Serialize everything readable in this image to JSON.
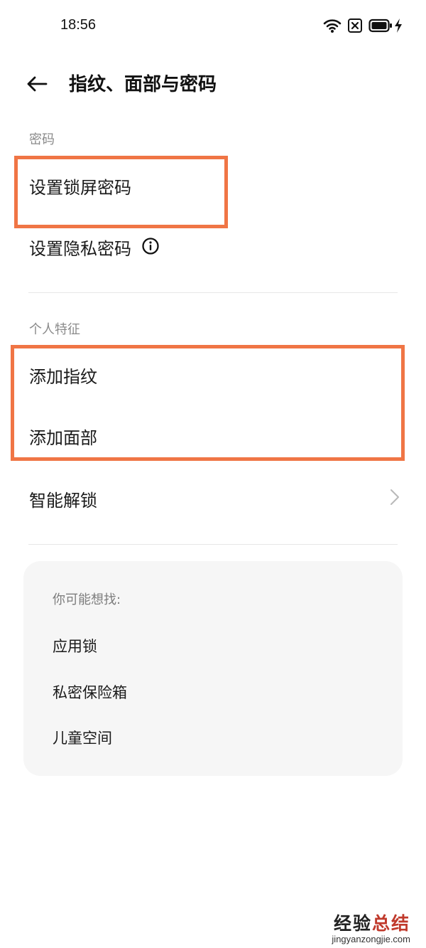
{
  "status_bar": {
    "time": "18:56",
    "icons": [
      "wifi-icon",
      "sim-error-icon",
      "battery-icon",
      "charging-icon"
    ]
  },
  "header": {
    "back_icon": "arrow-left-icon",
    "title": "指纹、面部与密码"
  },
  "password_section": {
    "label": "密码",
    "items": [
      {
        "label": "设置锁屏密码",
        "highlighted": true
      },
      {
        "label": "设置隐私密码",
        "info_icon": "info-icon"
      }
    ]
  },
  "biometric_section": {
    "label": "个人特征",
    "items": [
      {
        "label": "添加指纹",
        "highlighted": true
      },
      {
        "label": "添加面部",
        "highlighted": true
      },
      {
        "label": "智能解锁",
        "chevron": "chevron-right-icon"
      }
    ]
  },
  "suggestions": {
    "label": "你可能想找:",
    "items": [
      "应用锁",
      "私密保险箱",
      "儿童空间"
    ]
  },
  "watermark": {
    "title_part1": "经验",
    "title_part2": "总结",
    "url": "jingyanzongjie.com"
  },
  "colors": {
    "highlight_border": "#f07545",
    "card_background": "#f6f6f6",
    "section_label": "#8a8a8a"
  }
}
